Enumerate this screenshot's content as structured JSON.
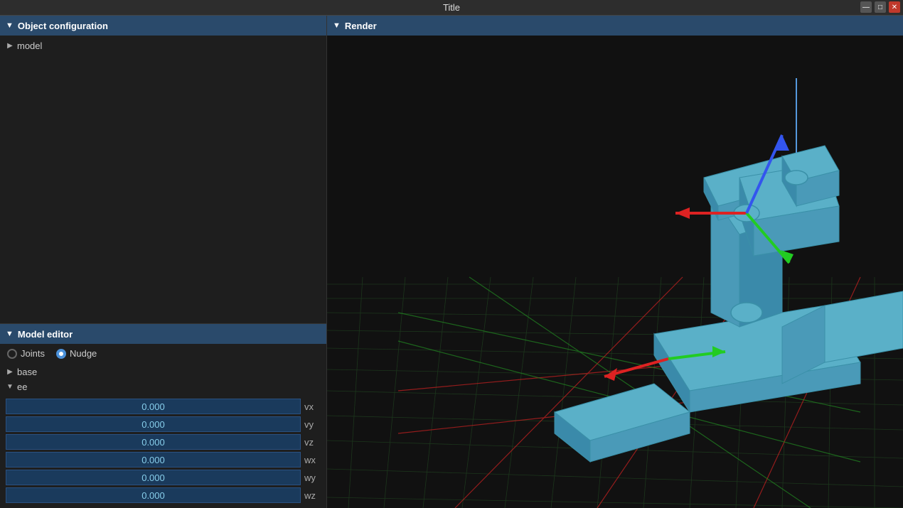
{
  "titleBar": {
    "title": "Title",
    "minLabel": "—",
    "maxLabel": "□",
    "closeLabel": "✕"
  },
  "leftPanel": {
    "objectConfig": {
      "headerIcon": "▼",
      "headerTitle": "Object configuration",
      "treeItems": [
        {
          "label": "model",
          "arrow": "▶",
          "indent": 0
        }
      ]
    },
    "modelEditor": {
      "headerIcon": "▼",
      "headerTitle": "Model editor",
      "radioOptions": [
        {
          "label": "Joints",
          "active": false
        },
        {
          "label": "Nudge",
          "active": true
        }
      ],
      "treeItems": [
        {
          "label": "base",
          "arrow": "▶",
          "indent": 0
        },
        {
          "label": "ee",
          "arrow": "▼",
          "indent": 0
        }
      ],
      "fields": [
        {
          "value": "0.000",
          "label": "vx"
        },
        {
          "value": "0.000",
          "label": "vy"
        },
        {
          "value": "0.000",
          "label": "vz"
        },
        {
          "value": "0.000",
          "label": "wx"
        },
        {
          "value": "0.000",
          "label": "wy"
        },
        {
          "value": "0.000",
          "label": "wz"
        }
      ]
    }
  },
  "rightPanel": {
    "headerIcon": "▼",
    "headerTitle": "Render"
  }
}
